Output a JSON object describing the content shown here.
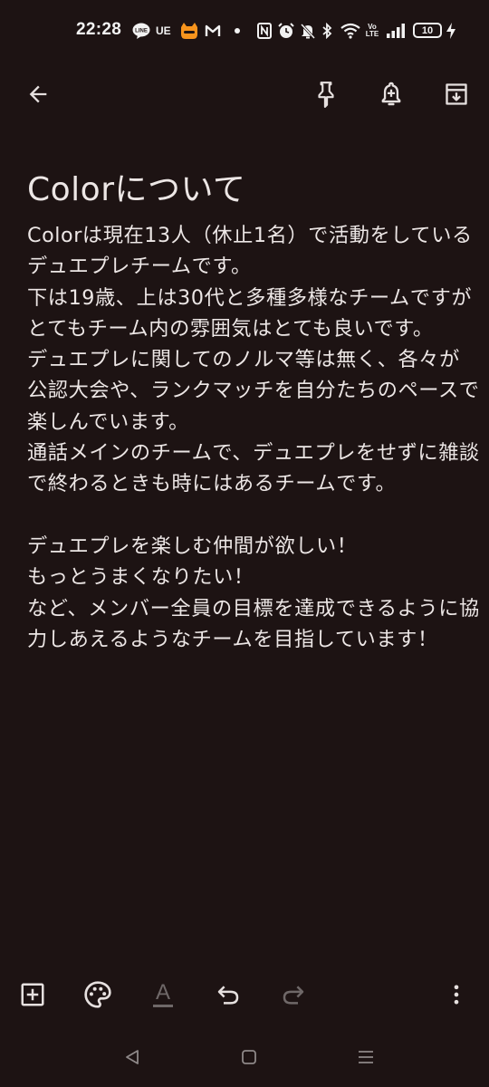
{
  "status_bar": {
    "time": "22:28",
    "ue_label": "UE",
    "volte_label": "Vo LTE",
    "battery": "10",
    "icons": [
      "line-icon",
      "ue-icon",
      "app-icon",
      "gmail-icon",
      "dot-icon",
      "nfc-icon",
      "alarm-icon",
      "mute-icon",
      "bluetooth-icon",
      "wifi-icon",
      "volte-icon",
      "signal-icon",
      "battery-icon",
      "charging-icon"
    ]
  },
  "toolbar": {
    "icons": [
      "back-arrow-icon",
      "pin-icon",
      "add-reminder-icon",
      "archive-icon"
    ]
  },
  "note": {
    "title": "Colorについて",
    "body": "Colorは現在13人（休止1名）で活動をしているデュエプレチームです。\n下は19歳、上は30代と多種多様なチームですがとてもチーム内の雰囲気はとても良いです。\nデュエプレに関してのノルマ等は無く、各々が公認大会や、ランクマッチを自分たちのペースで楽しんでいます。\n通話メインのチームで、デュエプレをせずに雑談で終わるときも時にはあるチームです。\n\nデュエプレを楽しむ仲間が欲しい！\nもっとうまくなりたい！\nなど、メンバー全員の目標を達成できるように協力しあえるようなチームを目指しています！"
  },
  "bottom_bar": {
    "text_format_glyph": "A",
    "icons": [
      "add-box-icon",
      "palette-icon",
      "text-format-icon",
      "undo-icon",
      "redo-icon",
      "more-vert-icon"
    ]
  },
  "nav_bar": {
    "icons": [
      "nav-back-icon",
      "nav-home-icon",
      "nav-recents-icon"
    ]
  },
  "colors": {
    "background": "#1d1313",
    "text": "#ece6e5",
    "icon": "#e6e0df",
    "disabled_icon": "#6f6868"
  }
}
